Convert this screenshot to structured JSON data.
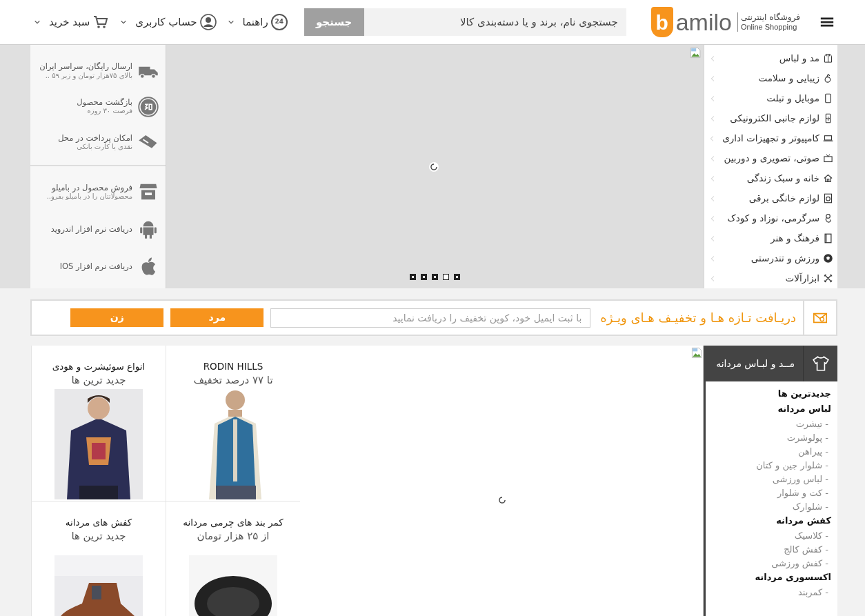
{
  "header": {
    "logo": {
      "mark": "b",
      "name": "amilo",
      "tagline_fa": "فروشگاه اینترنتی",
      "tagline_en": "Online Shopping"
    },
    "search": {
      "placeholder": "جستجوی نام، برند و یا دسته‌بندی کالا",
      "button": "جستجو"
    },
    "nav": [
      {
        "kind": "help",
        "label": "راهنما",
        "badge": "24"
      },
      {
        "kind": "account",
        "label": "حساب کاربری"
      },
      {
        "kind": "cart",
        "label": "سبد خرید"
      }
    ]
  },
  "categories": [
    {
      "kind": "fashion",
      "label": "مد و لباس"
    },
    {
      "kind": "beauty",
      "label": "زیبایی و سلامت"
    },
    {
      "kind": "mobile",
      "label": "موبایل و تبلت"
    },
    {
      "kind": "usb",
      "label": "لوازم جانبی الکترونیکی"
    },
    {
      "kind": "laptop",
      "label": "کامپیوتر و تجهیزات اداری"
    },
    {
      "kind": "tv",
      "label": "صوتی، تصویری و دوربین"
    },
    {
      "kind": "home",
      "label": "خانه و سبک زندگی"
    },
    {
      "kind": "appliance",
      "label": "لوازم خانگی برقی"
    },
    {
      "kind": "baby",
      "label": "سرگرمی، نوزاد و کودک"
    },
    {
      "kind": "book",
      "label": "فرهنگ و هنر"
    },
    {
      "kind": "ball",
      "label": "ورزش و تندرستی"
    },
    {
      "kind": "tools",
      "label": "ابزارآلات"
    }
  ],
  "slider": {
    "dots": [
      {
        "selected": false
      },
      {
        "selected": false
      },
      {
        "selected": false
      },
      {
        "selected": true
      },
      {
        "selected": false
      }
    ]
  },
  "features": [
    {
      "kind": "truck",
      "title": "ارسال رایگان، سراسر ایران",
      "subtitle": "بالای ۷۵هزار تومان و زیر ۵۹ .."
    },
    {
      "kind": "return",
      "title": "بازگشت محصول",
      "subtitle": "فرصت ۳۰ روزه"
    },
    {
      "kind": "pay",
      "title": "امکان پرداخت در محل",
      "subtitle": "نقدی یا کارت بانکی"
    }
  ],
  "links": [
    {
      "kind": "shop",
      "title": "فروش محصول در بامیلو",
      "subtitle": "محصولاتتان را در بامیلو بفرو.."
    },
    {
      "kind": "android",
      "title": "دریافت نرم افزار اندروید"
    },
    {
      "kind": "apple",
      "title": "دریافت نرم افزار IOS"
    }
  ],
  "newsletter": {
    "title": "دریـافت تـازه هـا و تخفیـف هـای ویـژه",
    "placeholder": "با ثبت ایمیل خود، کوپن تخفیف را دریافت نمایید",
    "buttons": [
      "مرد",
      "زن"
    ]
  },
  "section": {
    "title": "مــد و لبـاس مردانه",
    "groups": [
      {
        "heading": "جدیدترین ها"
      },
      {
        "heading": "لباس مردانه",
        "items": [
          "- تیشرت",
          "- پولوشرت",
          "- پیراهن",
          "- شلوار جین و کتان",
          "- لباس ورزشی",
          "- کت و شلوار",
          "- شلوارک"
        ]
      },
      {
        "heading": "کفش مردانه",
        "items": [
          "- کلاسیک",
          "- کفش کالج",
          "- کفش ورزشی"
        ]
      },
      {
        "heading": "اکسسوری مردانه",
        "items": [
          "- کمربند"
        ]
      }
    ]
  },
  "products": [
    {
      "kind": "vest",
      "title": "RODIN HILLS",
      "subtitle": "تا ۷۷ درصد تخفیف"
    },
    {
      "kind": "hoodie",
      "title": "انواع سوئیشرت و هودی",
      "subtitle": "جدید ترین ها"
    },
    {
      "kind": "belt",
      "title": "کمر بند های چرمی مردانه",
      "subtitle": "از ۲۵ هزار تومان"
    },
    {
      "kind": "shoe",
      "title": "کفش های مردانه",
      "subtitle": "جدید ترین ها"
    }
  ]
}
